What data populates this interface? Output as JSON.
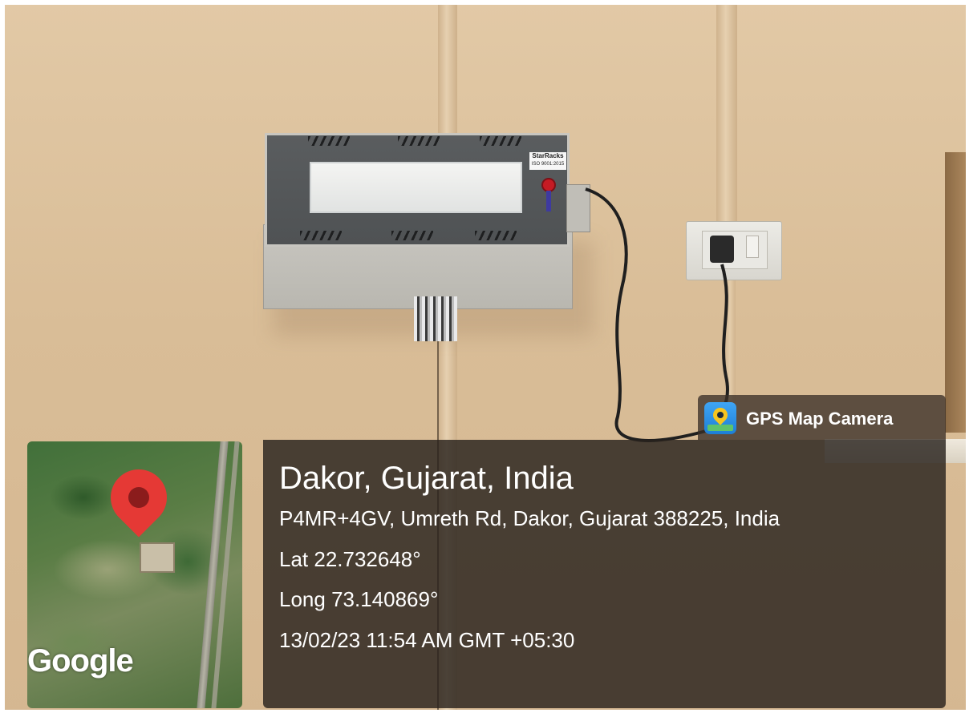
{
  "overlay": {
    "app_name": "GPS Map Camera",
    "app_icon": "gps-map-camera-icon",
    "place_title": "Dakor, Gujarat, India",
    "address": "P4MR+4GV, Umreth Rd, Dakor, Gujarat 388225, India",
    "latitude": "Lat 22.732648°",
    "longitude": "Long 73.140869°",
    "datetime": "13/02/23 11:54 AM GMT +05:30"
  },
  "map": {
    "attribution": "Google",
    "pin_icon": "location-pin-icon",
    "pin_color": "#e53935"
  },
  "scene": {
    "device_brand": "StarRacks",
    "device_badge_text": "ISO 9001:2015",
    "wall_color": "#dcc29f"
  }
}
